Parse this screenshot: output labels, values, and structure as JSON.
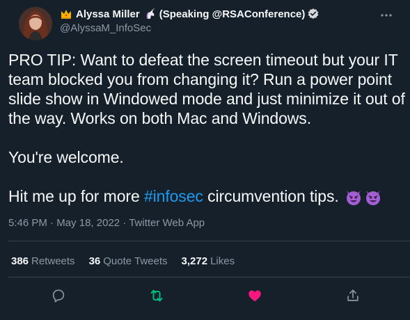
{
  "author": {
    "display_name_prefix": "Alyssa Miller",
    "display_name_suffix": "(Speaking @RSAConference)",
    "handle": "@AlyssaM_InfoSec",
    "icons": [
      "crown-icon",
      "unicorn-icon",
      "verified-badge-icon"
    ]
  },
  "tweet": {
    "paragraph_1": "PRO TIP: Want to defeat the screen timeout but your IT team blocked you from changing it? Run a power point slide show in Windowed mode and just minimize it out of the way. Works on both Mac and Windows.",
    "paragraph_2": "You're welcome.",
    "paragraph_3_before": "Hit me up for more ",
    "hashtag": "#infosec",
    "paragraph_3_after": " circumvention tips.",
    "emoji": [
      "smiling-devil-emoji",
      "smiling-devil-emoji"
    ]
  },
  "meta": {
    "time": "5:46 PM",
    "separator": "·",
    "date": "May 18, 2022",
    "source": "Twitter Web App"
  },
  "stats": {
    "retweets_count": "386",
    "retweets_label": "Retweets",
    "quotes_count": "36",
    "quotes_label": "Quote Tweets",
    "likes_count": "3,272",
    "likes_label": "Likes"
  },
  "colors": {
    "background": "#15202b",
    "text": "#f7f9f9",
    "secondary": "#8b98a5",
    "link": "#1d9bf0",
    "retweet_green": "#00ba7c",
    "like_pink": "#f91880",
    "divider": "#38444d"
  }
}
